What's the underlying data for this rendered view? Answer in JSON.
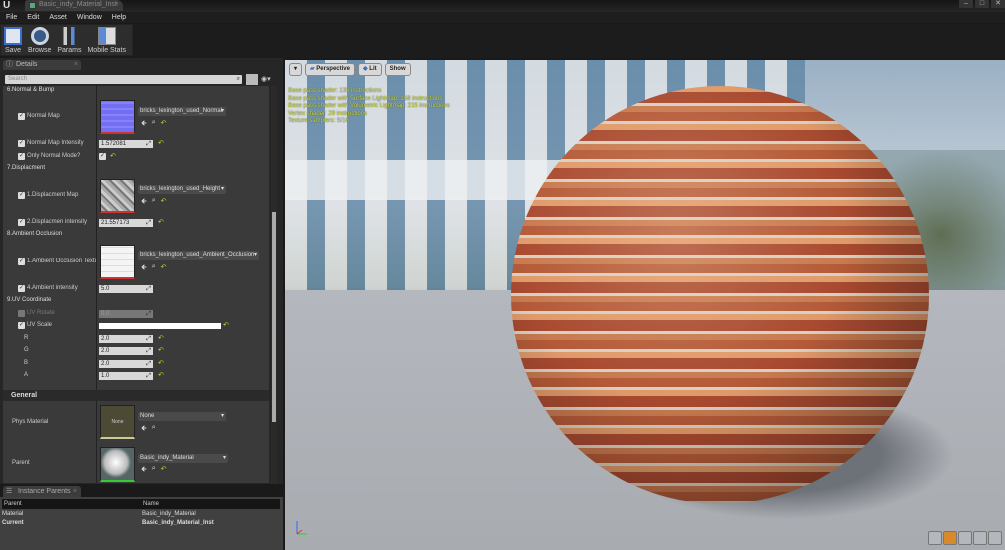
{
  "window": {
    "tab_title": "Basic_indy_Material_Inst",
    "minimize": "–",
    "maximize": "□",
    "close": "✕"
  },
  "menu": [
    "File",
    "Edit",
    "Asset",
    "Window",
    "Help"
  ],
  "toolbar": {
    "save": "Save",
    "browse": "Browse",
    "params": "Params",
    "mobile_stats": "Mobile Stats"
  },
  "details": {
    "tab": "Details",
    "search_placeholder": "Search",
    "categories": {
      "normal": "6.Normal & Bump",
      "displacement": "7.Displacment",
      "ao": "8.Ambient Occlusion",
      "uv": "9.UV Coordinate"
    },
    "normal_map": {
      "label": "Normal Map",
      "texture": "bricks_lexington_used_Normal"
    },
    "normal_intensity": {
      "label": "Normal Map Intensity",
      "value": "1.572081"
    },
    "only_normal": {
      "label": "Only Normal Mode?"
    },
    "disp_map": {
      "label": "1.Displacment Map",
      "texture": "bricks_lexington_used_Height"
    },
    "disp_intensity": {
      "label": "2.Displacmen intensity",
      "value": "21.557173"
    },
    "ao_tex": {
      "label": "1.Ambient Occlusion Textu",
      "texture": "bricks_lexington_used_Ambient_Occlusion"
    },
    "ao_intensity": {
      "label": "4.Ambient intensity",
      "value": "5.0"
    },
    "uv_rotate": {
      "label": "UV Rotate",
      "value": "0.0"
    },
    "uv_scale": {
      "label": "UV Scale",
      "r_label": "R",
      "r": "2.0",
      "g_label": "G",
      "g": "2.0",
      "b_label": "B",
      "b": "2.0",
      "a_label": "A",
      "a": "1.0"
    },
    "general": "General",
    "phys_material": {
      "label": "Phys Material",
      "thumb": "None",
      "value": "None"
    },
    "parent": {
      "label": "Parent",
      "value": "Basic_indy_Material"
    }
  },
  "instance_parents": {
    "tab": "Instance Parents",
    "headers": [
      "Parent",
      "Name"
    ],
    "rows": [
      {
        "parent": "Material",
        "name": "Basic_indy_Material"
      },
      {
        "parent": "Current",
        "name": "Basic_indy_Material_Inst"
      }
    ]
  },
  "viewport": {
    "perspective": "Perspective",
    "lit": "Lit",
    "show": "Show",
    "stats": [
      "Base pass shader: 133 instructions",
      "Base pass shader with Surface Lightmap: 158 instructions",
      "Base pass shader with Volumetric Lightmap: 215 instructions",
      "Vertex shader: 29 instructions",
      "Texture samplers: 5/16"
    ]
  }
}
